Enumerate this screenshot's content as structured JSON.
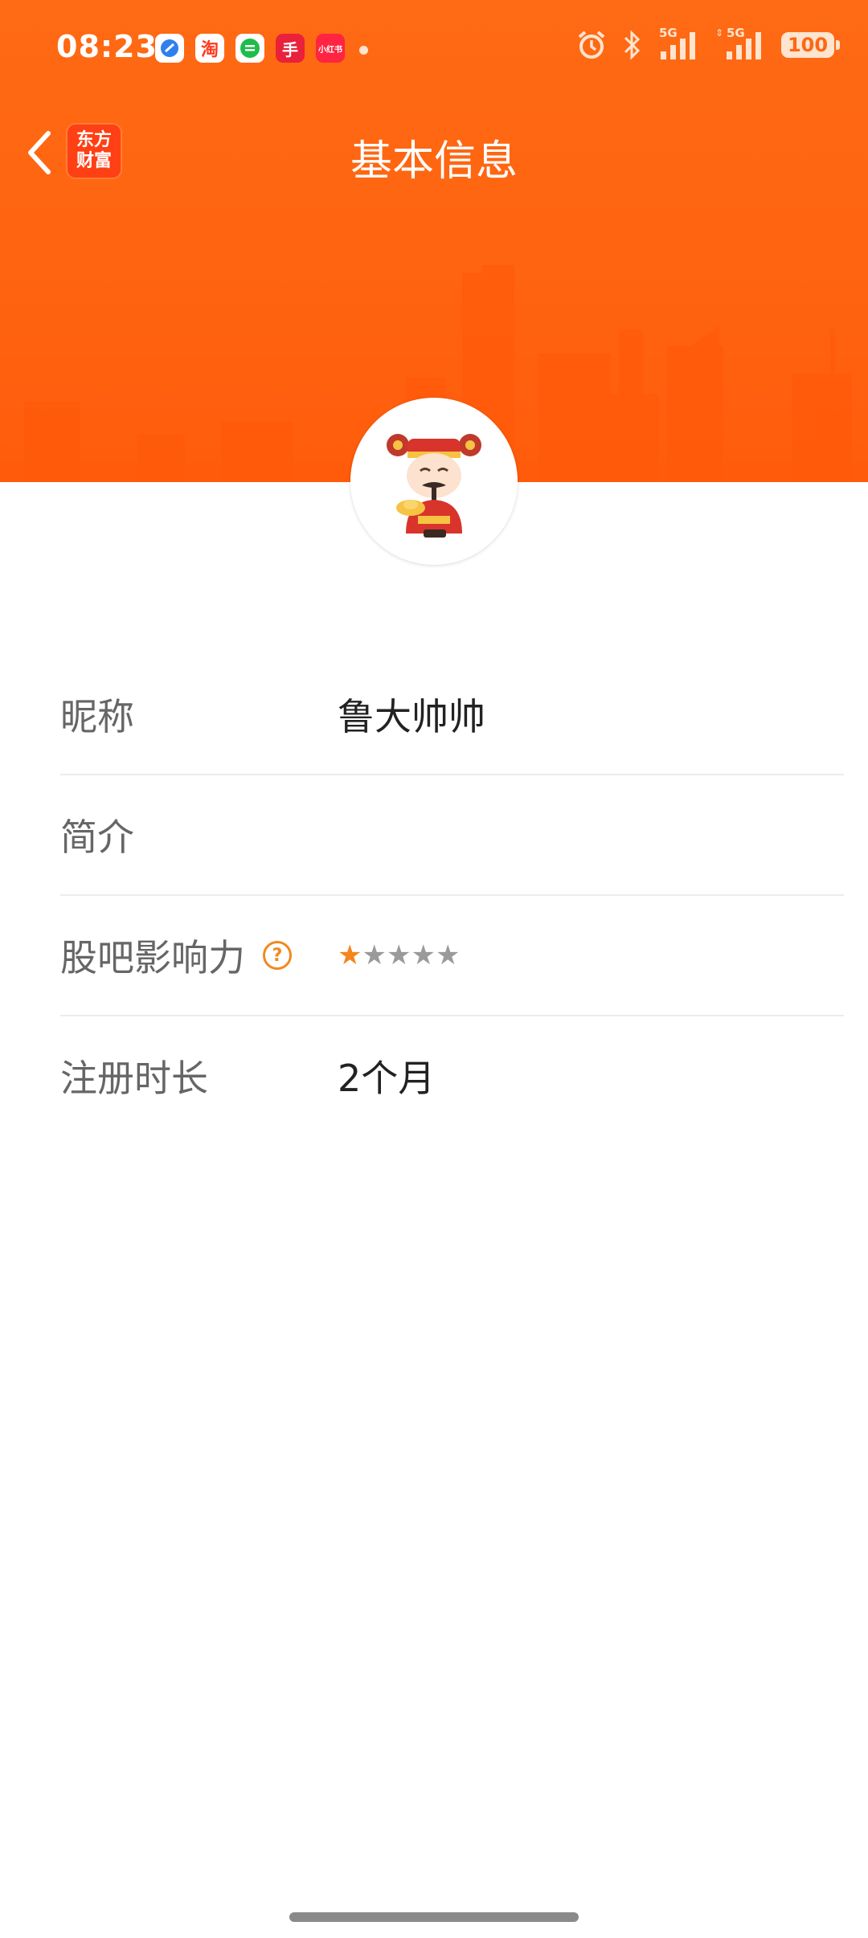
{
  "status_bar": {
    "time": "08:23",
    "notification_icons": [
      {
        "name": "browser-app-icon",
        "color": "#2f80ed",
        "glyph": "◐"
      },
      {
        "name": "taobao-app-icon",
        "color": "#ff3b1f",
        "glyph": "淘"
      },
      {
        "name": "wechat-app-icon",
        "color": "#1ebd4a",
        "glyph": "≡"
      },
      {
        "name": "shopping-app-icon",
        "color": "#e9213a",
        "glyph": "手"
      },
      {
        "name": "xiaohongshu-app-icon",
        "color": "#ff2442",
        "glyph": "小红书"
      }
    ],
    "network_1": "5G",
    "network_2": "5G",
    "battery": "100"
  },
  "nav": {
    "title": "基本信息",
    "app_logo_line1": "东方",
    "app_logo_line2": "财富"
  },
  "profile": {
    "rows": [
      {
        "label": "昵称",
        "value": "鲁大帅帅"
      },
      {
        "label": "简介",
        "value": ""
      },
      {
        "label": "股吧影响力",
        "help": "?",
        "rating": 1,
        "max_rating": 5
      },
      {
        "label": "注册时长",
        "value": "2个月"
      }
    ]
  },
  "colors": {
    "banner": "#ff6612",
    "star_active": "#f5851f",
    "star_inactive": "#9a9a9a"
  }
}
